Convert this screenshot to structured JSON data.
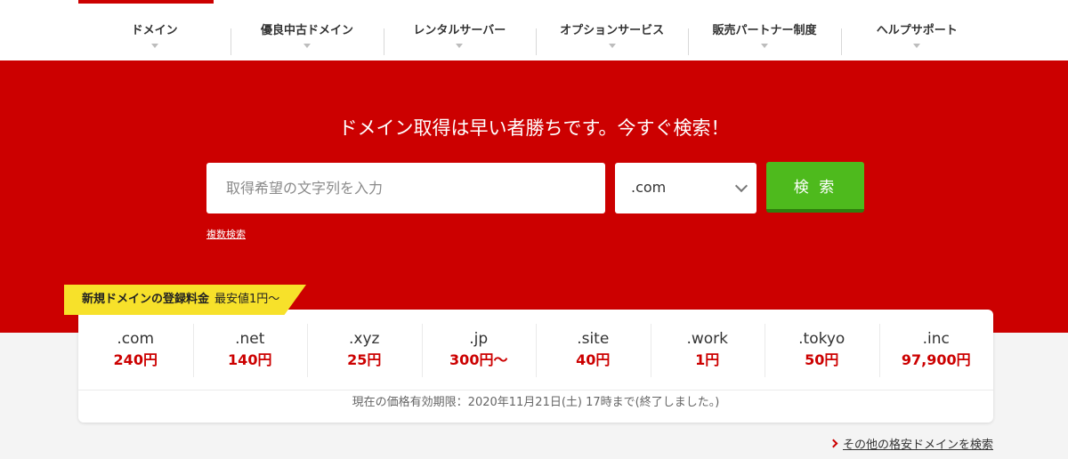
{
  "nav": {
    "items": [
      {
        "label": "ドメイン"
      },
      {
        "label": "優良中古ドメイン"
      },
      {
        "label": "レンタルサーバー"
      },
      {
        "label": "オプションサービス"
      },
      {
        "label": "販売パートナー制度"
      },
      {
        "label": "ヘルプサポート"
      }
    ]
  },
  "hero": {
    "title": "ドメイン取得は早い者勝ちです。今すぐ検索！",
    "search_placeholder": "取得希望の文字列を入力",
    "search_value": "",
    "tld_selected": ".com",
    "search_button": "検 索",
    "multi_search_link": "複数検索"
  },
  "pricing": {
    "tag_title": "新規ドメインの登録料金",
    "tag_sub": "最安値1円〜",
    "items": [
      {
        "tld": ".com",
        "price": "240円"
      },
      {
        "tld": ".net",
        "price": "140円"
      },
      {
        "tld": ".xyz",
        "price": "25円"
      },
      {
        "tld": ".jp",
        "price": "300円〜"
      },
      {
        "tld": ".site",
        "price": "40円"
      },
      {
        "tld": ".work",
        "price": "1円"
      },
      {
        "tld": ".tokyo",
        "price": "50円"
      },
      {
        "tld": ".inc",
        "price": "97,900円"
      }
    ],
    "validity_note": "現在の価格有効期限：2020年11月21日(土) 17時まで(終了しました。)"
  },
  "more_link": "その他の格安ドメインを検索",
  "colors": {
    "brand_red": "#cc0000",
    "search_green": "#4eba1d",
    "tag_yellow": "#f7e12a"
  }
}
